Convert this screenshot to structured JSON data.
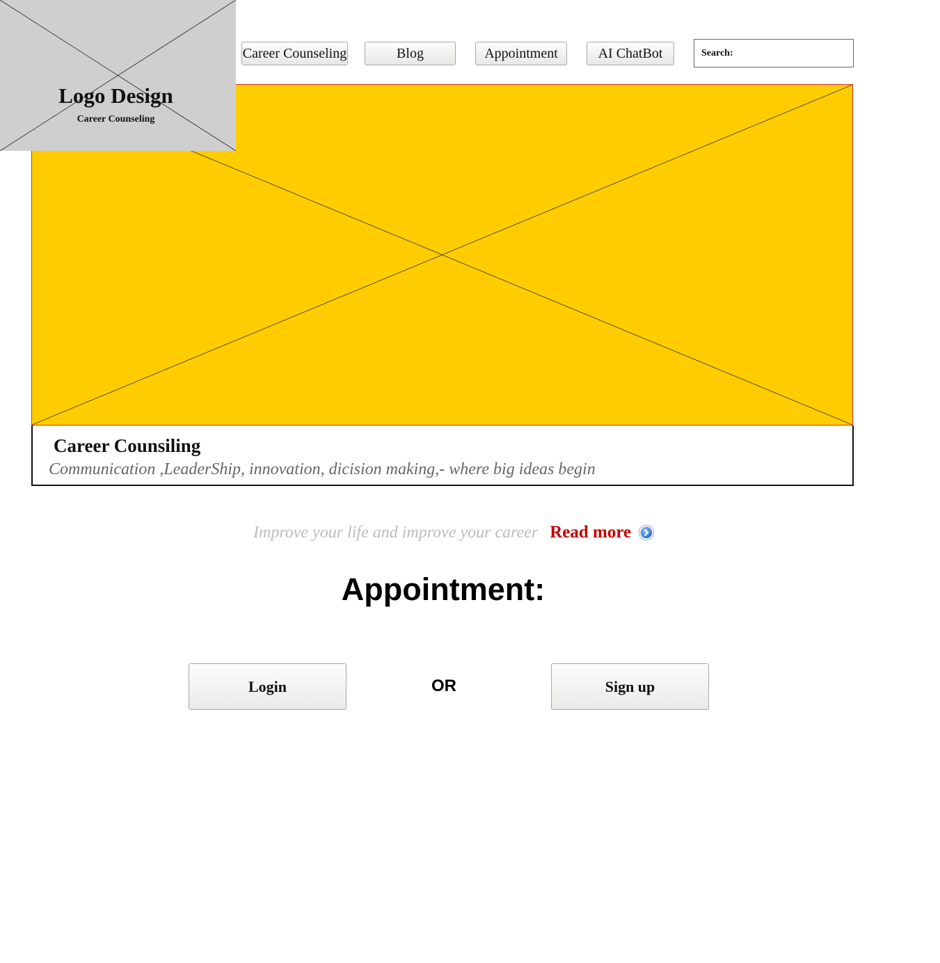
{
  "logo": {
    "title": "Logo Design",
    "subtitle": "Career Counseling"
  },
  "nav": {
    "items": [
      {
        "label": "Career Counseling"
      },
      {
        "label": "Blog"
      },
      {
        "label": "Appointment"
      },
      {
        "label": "AI ChatBot"
      }
    ]
  },
  "search": {
    "label": "Search:",
    "value": ""
  },
  "hero": {
    "title": "Career Counsiling",
    "subtitle": "Communication ,LeaderShip, innovation, dicision making,- where big ideas begin",
    "colors": {
      "fill": "#ffcc00",
      "border": "#d32f2f"
    }
  },
  "tagline": {
    "text": "Improve your life and improve your career",
    "read_more": "Read more",
    "icon": "chevron-right-circle-icon"
  },
  "appointment": {
    "heading": "Appointment:",
    "login_label": "Login",
    "or_text": "OR",
    "signup_label": "Sign up"
  }
}
